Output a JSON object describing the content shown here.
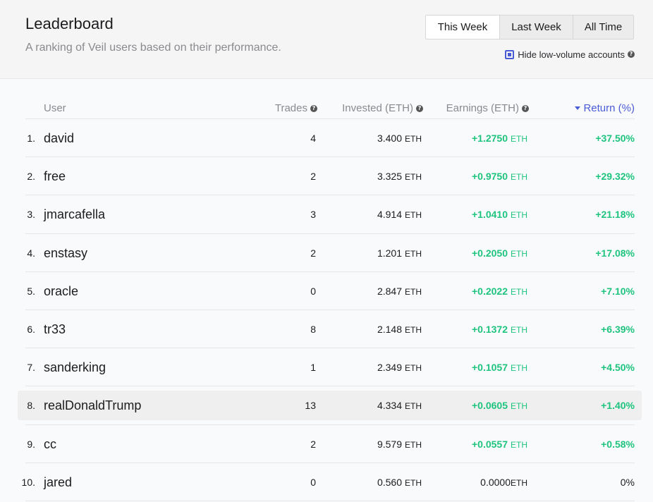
{
  "header": {
    "title": "Leaderboard",
    "subtitle": "A ranking of Veil users based on their performance.",
    "tabs": [
      "This Week",
      "Last Week",
      "All Time"
    ],
    "selected_tab": "This Week",
    "hide_low_volume": {
      "label": "Hide low-volume accounts",
      "checked": true
    }
  },
  "table": {
    "columns": {
      "user": "User",
      "trades": "Trades",
      "invested": "Invested (ETH)",
      "earnings": "Earnings (ETH)",
      "return": "Return (%)"
    },
    "sort": {
      "column": "return",
      "direction": "descending"
    },
    "unit": "ETH",
    "rows": [
      {
        "rank": "1.",
        "user": "david",
        "trades": "4",
        "invested": "3.400",
        "earnings": "+1.2750",
        "return": "+37.50%"
      },
      {
        "rank": "2.",
        "user": "free",
        "trades": "2",
        "invested": "3.325",
        "earnings": "+0.9750",
        "return": "+29.32%"
      },
      {
        "rank": "3.",
        "user": "jmarcafella",
        "trades": "3",
        "invested": "4.914",
        "earnings": "+1.0410",
        "return": "+21.18%"
      },
      {
        "rank": "4.",
        "user": "enstasy",
        "trades": "2",
        "invested": "1.201",
        "earnings": "+0.2050",
        "return": "+17.08%"
      },
      {
        "rank": "5.",
        "user": "oracle",
        "trades": "0",
        "invested": "2.847",
        "earnings": "+0.2022",
        "return": "+7.10%"
      },
      {
        "rank": "6.",
        "user": "tr33",
        "trades": "8",
        "invested": "2.148",
        "earnings": "+0.1372",
        "return": "+6.39%"
      },
      {
        "rank": "7.",
        "user": "sanderking",
        "trades": "1",
        "invested": "2.349",
        "earnings": "+0.1057",
        "return": "+4.50%"
      },
      {
        "rank": "8.",
        "user": "realDonaldTrump",
        "trades": "13",
        "invested": "4.334",
        "earnings": "+0.0605",
        "return": "+1.40%"
      },
      {
        "rank": "9.",
        "user": "cc",
        "trades": "2",
        "invested": "9.579",
        "earnings": "+0.0557",
        "return": "+0.58%"
      },
      {
        "rank": "10.",
        "user": "jared",
        "trades": "0",
        "invested": "0.560",
        "earnings": "0.0000",
        "return": "0%"
      }
    ],
    "highlighted_row": "realDonaldTrump"
  },
  "colors": {
    "accent": "#4a5bd6",
    "positive": "#1ec47e",
    "header_bg": "#f5f5f5",
    "row_highlight": "#efefef"
  },
  "icons": [
    "help-icon",
    "caret-down-icon",
    "checkbox-icon"
  ]
}
